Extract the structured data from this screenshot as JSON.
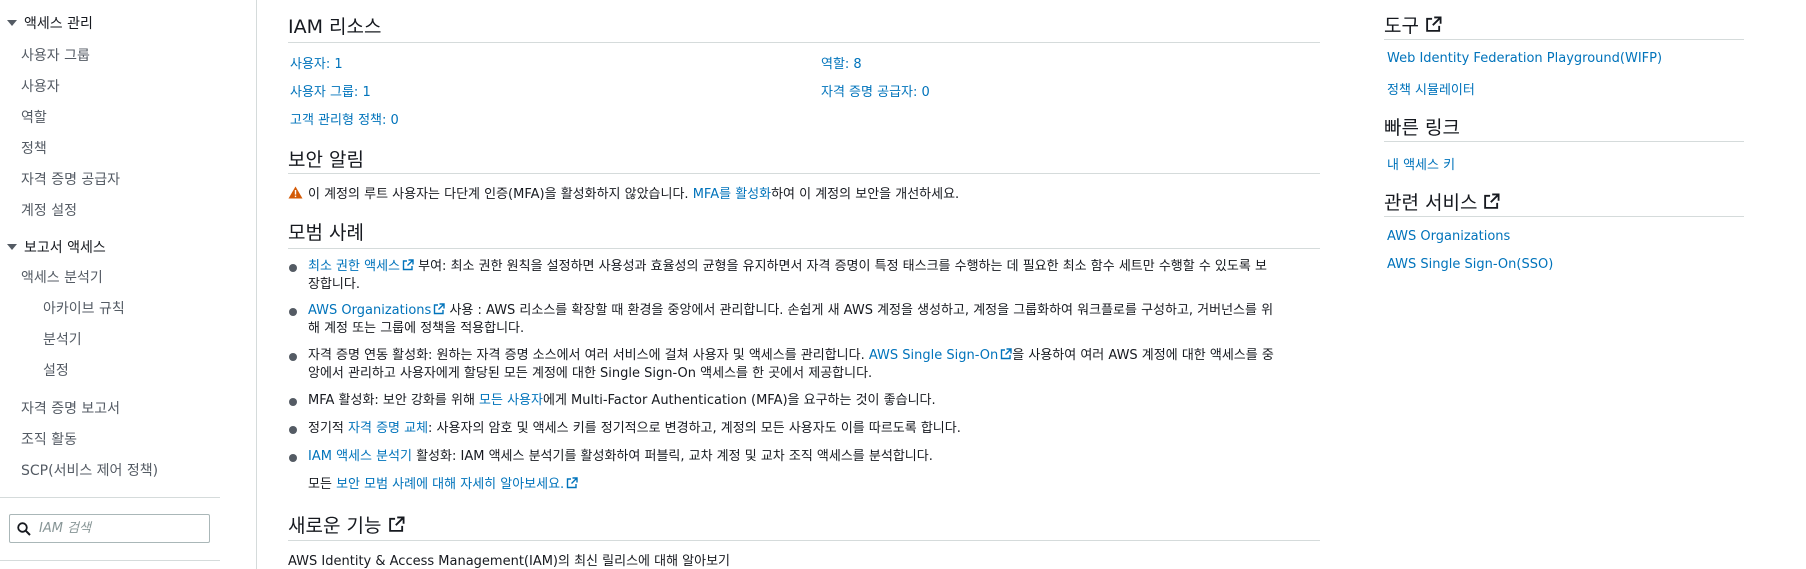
{
  "sidebar": {
    "access_mgmt": "액세스 관리",
    "items1": [
      "사용자 그룹",
      "사용자",
      "역할",
      "정책",
      "자격 증명 공급자",
      "계정 설정"
    ],
    "reports": "보고서 액세스",
    "access_analyzer": "액세스 분석기",
    "analyzer_subitems": [
      "아카이브 규칙",
      "분석기",
      "설정"
    ],
    "items2": [
      "자격 증명 보고서",
      "조직 활동",
      "SCP(서비스 제어 정책)"
    ],
    "search_placeholder": "IAM 검색"
  },
  "resources": {
    "title": "IAM 리소스",
    "users": "사용자: 1",
    "user_groups": "사용자 그룹: 1",
    "managed_policies": "고객 관리형 정책: 0",
    "roles": "역할: 8",
    "identity_providers": "자격 증명 공급자: 0"
  },
  "alert": {
    "title": "보안 알림",
    "text_before": "이 계정의 루트 사용자는 다단계 인증(MFA)을 활성화하지 않았습니다. ",
    "link": "MFA를 활성화",
    "text_after": "하여 이 계정의 보안을 개선하세요."
  },
  "best_practices": {
    "title": "모범 사례",
    "bp1_link": "최소 권한 액세스",
    "bp1_text": " 부여: 최소 권한 원칙을 설정하면 사용성과 효율성의 균형을 유지하면서 자격 증명이 특정 태스크를 수행하는 데 필요한 최소 함수 세트만 수행할 수 있도록 보장합니다.",
    "bp2_link": "AWS Organizations",
    "bp2_text": " 사용 : AWS 리소스를 확장할 때 환경을 중앙에서 관리합니다. 손쉽게 새 AWS 계정을 생성하고, 계정을 그룹화하여 워크플로를 구성하고, 거버넌스를 위해 계정 또는 그룹에 정책을 적용합니다.",
    "bp3_text_before": "자격 증명 연동 활성화: 원하는 자격 증명 소스에서 여러 서비스에 걸쳐 사용자 및 액세스를 관리합니다. ",
    "bp3_link": "AWS Single Sign-On",
    "bp3_text_after": "을 사용하여 여러 AWS 계정에 대한 액세스를 중앙에서 관리하고 사용자에게 할당된 모든 계정에 대한 Single Sign-On 액세스를 한 곳에서 제공합니다.",
    "bp4_text_before": "MFA 활성화: 보안 강화를 위해 ",
    "bp4_link": "모든 사용자",
    "bp4_text_after": "에게 Multi-Factor Authentication (MFA)을 요구하는 것이 좋습니다.",
    "bp5_text_before": "정기적 ",
    "bp5_link": "자격 증명 교체",
    "bp5_text_after": ": 사용자의 암호 및 액세스 키를 정기적으로 변경하고, 계정의 모든 사용자도 이를 따르도록 합니다.",
    "bp6_link": "IAM 액세스 분석기",
    "bp6_text": " 활성화: IAM 액세스 분석기를 활성화하여 퍼블릭, 교차 계정 및 교차 조직 액세스를 분석합니다.",
    "more_before": "모든 ",
    "more_link": "보안 모범 사례에 대해 자세히 알아보세요."
  },
  "whats_new": {
    "title": "새로운 기능",
    "text": "AWS Identity & Access Management(IAM)의 최신 릴리스에 대해 알아보기"
  },
  "tools": {
    "title": "도구",
    "links": [
      "Web Identity Federation Playground(WIFP)",
      "정책 시뮬레이터"
    ]
  },
  "quick_links": {
    "title": "빠른 링크",
    "links": [
      "내 액세스 키"
    ]
  },
  "related": {
    "title": "관련 서비스",
    "links": [
      "AWS Organizations",
      "AWS Single Sign-On(SSO)"
    ]
  },
  "colors": {
    "link": "#0073bb",
    "warning": "#d45b07",
    "divider": "#d5dbdb"
  },
  "icons": [
    "caret-down-icon",
    "warning-icon",
    "external-link-icon",
    "search-icon"
  ]
}
